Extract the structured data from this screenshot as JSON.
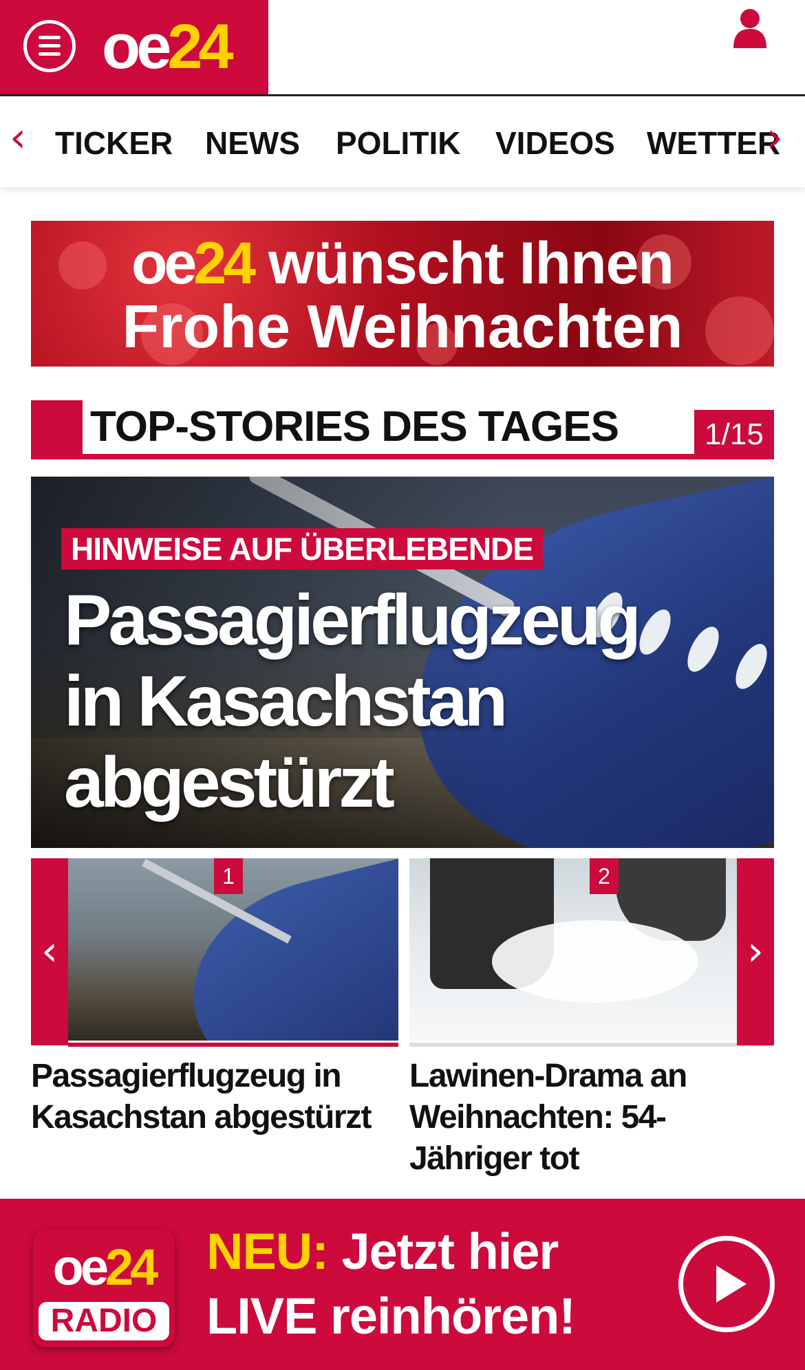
{
  "header": {
    "logo_oe": "oe",
    "logo_24": "24",
    "menu_icon": "hamburger-menu-icon",
    "user_icon": "user-icon"
  },
  "nav": {
    "items": [
      "TICKER",
      "NEWS",
      "POLITIK",
      "VIDEOS",
      "WETTER"
    ],
    "prev_arrow": "‹",
    "next_arrow": "›"
  },
  "banner": {
    "logo_oe": "oe",
    "logo_24": "24",
    "line1_rest": " wünscht Ihnen",
    "line2": "Frohe Weihnachten"
  },
  "section": {
    "title": "TOP-STORIES DES TAGES",
    "counter": "1/15"
  },
  "hero": {
    "kicker": "HINWEISE AUF ÜBERLEBENDE",
    "title_line1": "Passagierflugzeug",
    "title_line2": "in Kasachstan",
    "title_line3": "abgestürzt"
  },
  "carousel": {
    "prev_arrow": "‹",
    "next_arrow": "›",
    "items": [
      {
        "number": "1",
        "caption": "Passagierflugzeug in Kasachstan abgestürzt"
      },
      {
        "number": "2",
        "caption": "Lawinen-Drama an Weihnachten: 54-Jähriger tot"
      }
    ]
  },
  "radio": {
    "logo_oe": "oe",
    "logo_24": "24",
    "logo_label": "RADIO",
    "neu": "NEU:",
    "line1_rest": " Jetzt hier",
    "line2": "LIVE reinhören!",
    "play_icon": "play-icon"
  },
  "colors": {
    "brand_red": "#cc0a3c",
    "brand_yellow": "#ffd200"
  }
}
